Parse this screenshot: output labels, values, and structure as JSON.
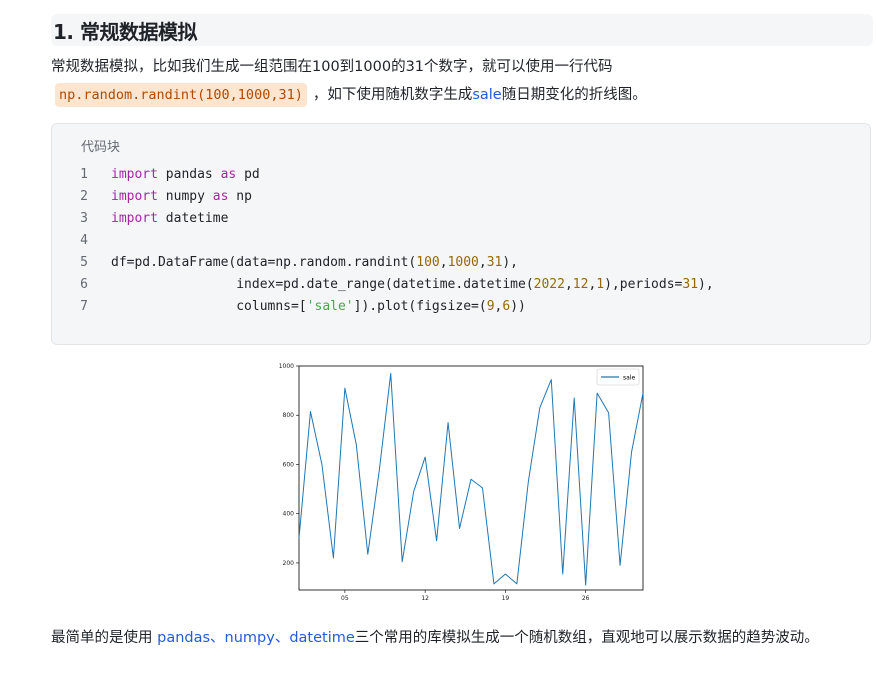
{
  "section": {
    "title": "1. 常规数据模拟"
  },
  "intro": {
    "line1": "常规数据模拟，比如我们生成一组范围在100到1000的31个数字，就可以使用一行代码",
    "code": "np.random.randint(100,1000,31)",
    "line2_a": "，如下使用随机数字生成",
    "line2_link": "sale",
    "line2_b": "随日期变化的折线图。"
  },
  "code_block": {
    "title": "代码块",
    "line_numbers": [
      "1",
      "2",
      "3",
      "4",
      "5",
      "6",
      "7"
    ],
    "lines": [
      "import pandas as pd",
      "import numpy as np",
      "import datetime",
      "",
      "df=pd.DataFrame(data=np.random.randint(100,1000,31),",
      "                index=pd.date_range(datetime.datetime(2022,12,1),periods=31),",
      "                columns=['sale']).plot(figsize=(9,6))"
    ]
  },
  "chart_data": {
    "type": "line",
    "legend": [
      "sale"
    ],
    "legend_position": "top-right",
    "line_color": "#1f77b4",
    "x": [
      1,
      2,
      3,
      4,
      5,
      6,
      7,
      8,
      9,
      10,
      11,
      12,
      13,
      14,
      15,
      16,
      17,
      18,
      19,
      20,
      21,
      22,
      23,
      24,
      25,
      26,
      27,
      28,
      29,
      30,
      31
    ],
    "series": [
      {
        "name": "sale",
        "values": [
          300,
          815,
          600,
          220,
          910,
          680,
          235,
          575,
          970,
          205,
          490,
          630,
          290,
          770,
          340,
          540,
          505,
          115,
          155,
          115,
          530,
          830,
          945,
          155,
          870,
          110,
          890,
          810,
          190,
          650,
          890
        ]
      }
    ],
    "yticks": [
      "200",
      "400",
      "600",
      "800",
      "1000"
    ],
    "xticks": [
      "05",
      "12",
      "19",
      "26"
    ],
    "xlim": [
      1,
      31
    ],
    "ylim": [
      90,
      1000
    ],
    "grid": false
  },
  "outro": {
    "text_a": "最简单的是使用 ",
    "libs": "pandas、numpy、datetime",
    "text_b": "三个常用的库模拟生成一个随机数组，直观地可以展示数据的趋势波动。"
  }
}
